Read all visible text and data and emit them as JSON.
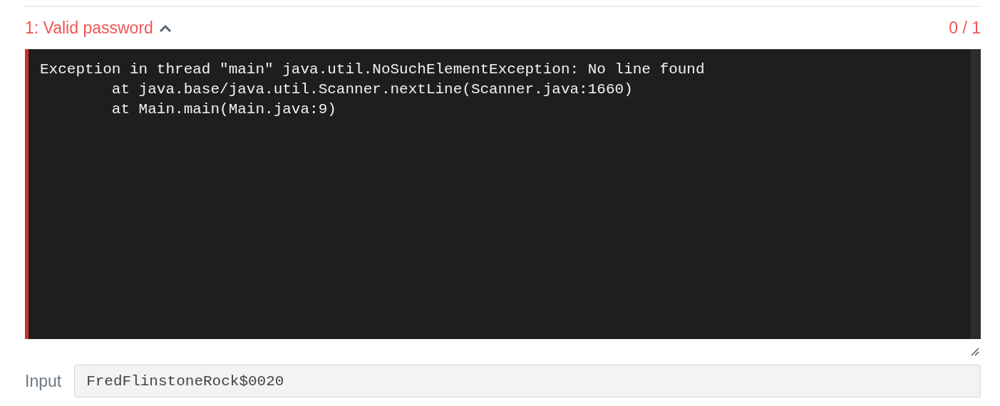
{
  "test": {
    "title": "1: Valid password",
    "expanded": true,
    "passed": false,
    "score": "0 / 1"
  },
  "output": {
    "lines": [
      "Exception in thread \"main\" java.util.NoSuchElementException: No line found",
      "        at java.base/java.util.Scanner.nextLine(Scanner.java:1660)",
      "        at Main.main(Main.java:9)"
    ]
  },
  "input": {
    "label": "Input",
    "value": "FredFlinstoneRock$0020"
  }
}
